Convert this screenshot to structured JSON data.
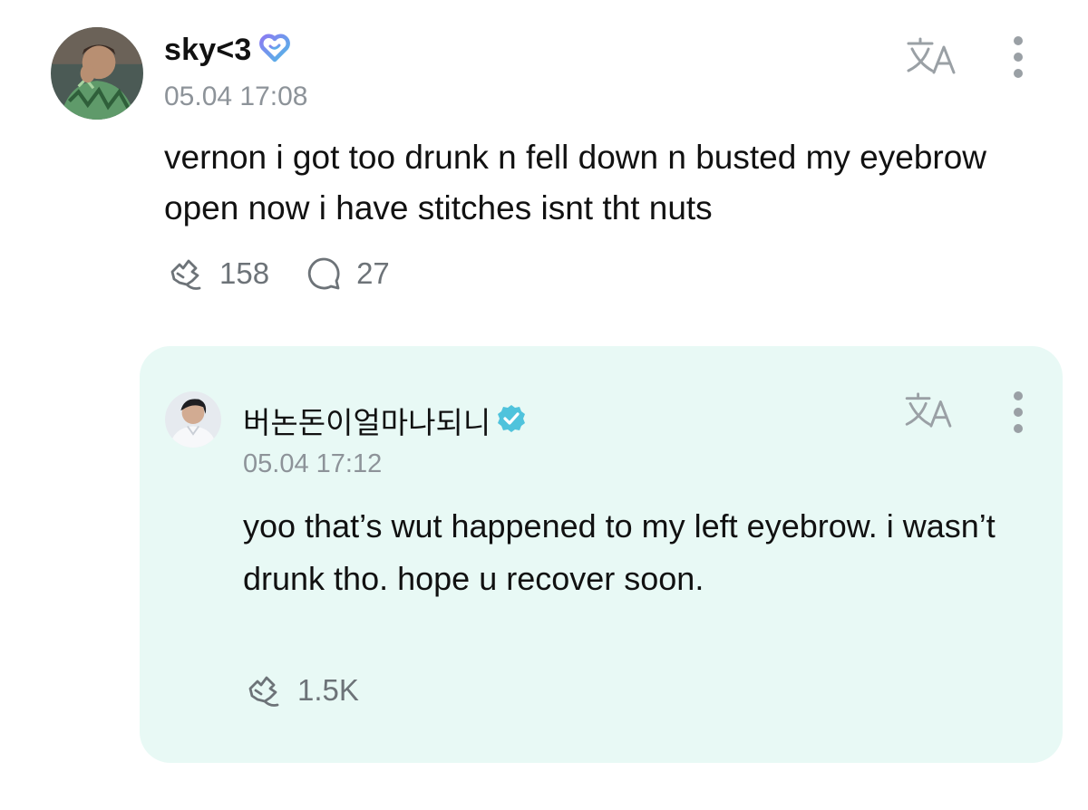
{
  "post": {
    "author": "sky<3",
    "timestamp": "05.04 17:08",
    "text": "vernon i got too drunk n fell down n busted my eyebrow open now i have stitches isnt tht nuts",
    "like_count": "158",
    "comment_count": "27",
    "badge_icon": "heart-outline-badge-icon",
    "badge_color": "#6f7cf0"
  },
  "reply": {
    "author": "버논돈이얼마나되니",
    "timestamp": "05.04 17:12",
    "text": "yoo that’s wut happened to my left eyebrow. i wasn’t drunk tho. hope u recover soon.",
    "like_count": "1.5K",
    "badge_icon": "verified-check-icon",
    "badge_color": "#4fc3dc",
    "background": "#e8f9f5"
  },
  "icons": {
    "translate": "translate-icon",
    "more": "more-vertical-icon",
    "like": "like-hand-icon",
    "comment": "comment-bubble-icon"
  }
}
